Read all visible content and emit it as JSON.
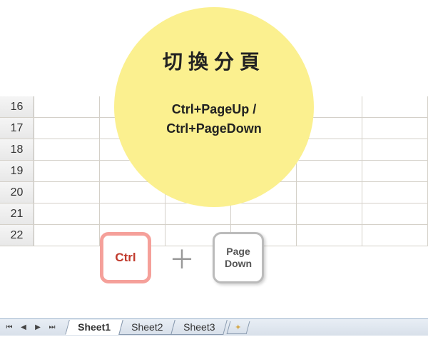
{
  "circle": {
    "title": "切換分頁",
    "subtitle_line1": "Ctrl+PageUp /",
    "subtitle_line2": "Ctrl+PageDown"
  },
  "rows": [
    "16",
    "17",
    "18",
    "19",
    "20",
    "21",
    "22"
  ],
  "keys": {
    "ctrl": "Ctrl",
    "plus": "＋",
    "pagedown": "Page\nDown"
  },
  "tabs": {
    "items": [
      {
        "label": "Sheet1",
        "active": true
      },
      {
        "label": "Sheet2",
        "active": false
      },
      {
        "label": "Sheet3",
        "active": false
      }
    ]
  },
  "nav": {
    "first": "⏮",
    "prev": "◀",
    "next": "▶",
    "last": "⏭"
  }
}
